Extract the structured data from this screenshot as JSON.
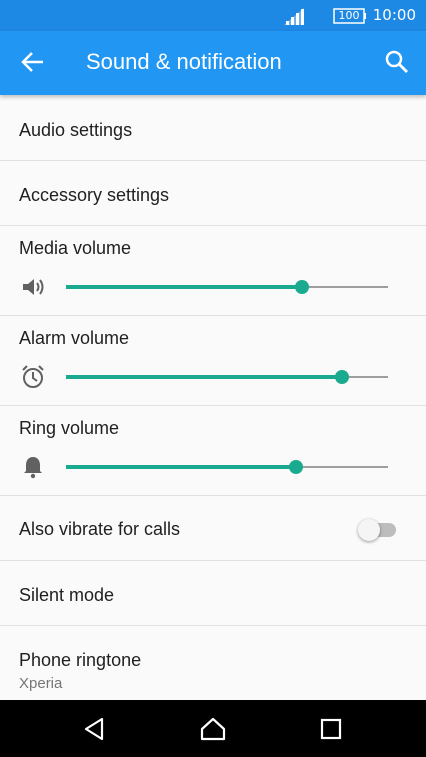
{
  "status_bar": {
    "battery": "100",
    "time": "10:00"
  },
  "app_bar": {
    "title": "Sound & notification"
  },
  "settings": {
    "audio": "Audio settings",
    "accessory": "Accessory settings",
    "media": {
      "label": "Media volume",
      "level": 0.733
    },
    "alarm": {
      "label": "Alarm volume",
      "level": 0.857
    },
    "ring": {
      "label": "Ring volume",
      "level": 0.714
    },
    "vibrate": {
      "label": "Also vibrate for calls",
      "on": false
    },
    "silent": "Silent mode",
    "ringtone": {
      "label": "Phone ringtone",
      "value": "Xperia"
    }
  },
  "colors": {
    "status_bar": "#1e88e5",
    "app_bar": "#2196f3",
    "accent": "#1aaa8f"
  },
  "icons": [
    "signal-icon",
    "battery-icon",
    "back-arrow-icon",
    "search-icon",
    "speaker-icon",
    "alarm-clock-icon",
    "bell-icon",
    "nav-back-icon",
    "nav-home-icon",
    "nav-recents-icon"
  ]
}
